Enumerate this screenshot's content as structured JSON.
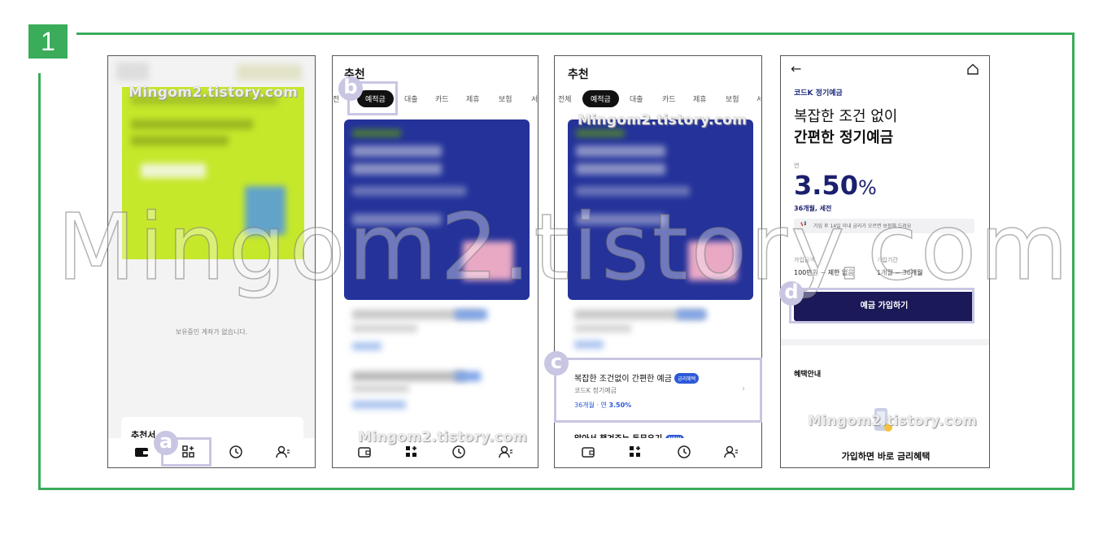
{
  "step": {
    "number": "1"
  },
  "watermark": {
    "main": "Mingom2.tistory.com",
    "small": "Mingom2.tistory.com"
  },
  "labels": {
    "a": "a",
    "b": "b",
    "c": "c",
    "d": "d"
  },
  "phone1": {
    "empty_text": "보유중인 계좌가 없습니다.",
    "section_title": "추천서",
    "nav": [
      "wallet-icon",
      "grid-icon",
      "clock-icon",
      "user-icon"
    ]
  },
  "phone2": {
    "title": "추천",
    "tabs": [
      "전",
      "예적금",
      "대출",
      "카드",
      "제휴",
      "보험",
      "서"
    ],
    "nav": [
      "wallet-icon",
      "grid-icon",
      "clock-icon",
      "user-icon"
    ]
  },
  "phone3": {
    "title": "추천",
    "tabs": [
      "전체",
      "예적금",
      "대출",
      "카드",
      "제휴",
      "보험",
      "서"
    ],
    "product": {
      "headline": "복잡한 조건없이 간편한 예금",
      "badge": "금리혜택",
      "name": "코드K 정기예금",
      "terms_prefix": "36개월 · 연 ",
      "rate": "3.50%"
    },
    "next_text": "알아서 챙겨주는 동무우기",
    "next_badge": "NEW",
    "nav": [
      "wallet-icon",
      "grid-icon",
      "clock-icon",
      "user-icon"
    ]
  },
  "phone4": {
    "back": "←",
    "product_name": "코드K 정기예금",
    "headline1": "복잡한 조건 없이",
    "headline2": "간편한 정기예금",
    "rate_prefix": "연",
    "rate_value": "3.50",
    "rate_unit": "%",
    "rate_terms": "36개월, 세전",
    "notice": "가입 후 14일 이내 금리가 오르면 보장해 드려요",
    "amount_label": "가입금액",
    "amount_value": "100만원 ~ 제한 없음",
    "period_label": "가입기간",
    "period_value": "1개월 ~ 36개월",
    "join_button": "예금 가입하기",
    "benefits_title": "혜택안내",
    "benefits_text": "가입하면 바로 금리혜택"
  }
}
